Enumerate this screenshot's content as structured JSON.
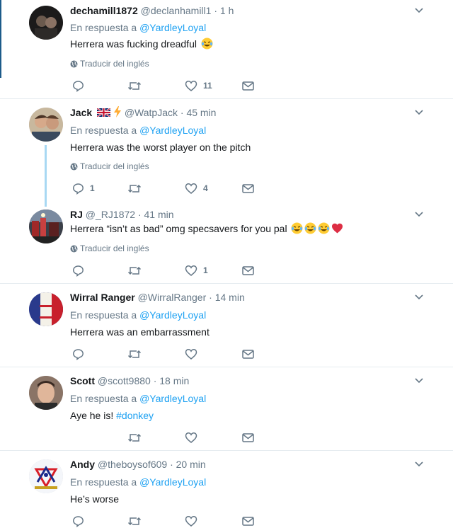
{
  "tweets": [
    {
      "name": "dechamill1872",
      "handle": "@declanhamill1",
      "time": "1 h",
      "reply_prefix": "En respuesta a",
      "reply_to": "@YardleyLoyal",
      "text": "Herrera was fucking dreadful",
      "translate": "Traducir del inglés",
      "reply_count": "",
      "like_count": "11"
    },
    {
      "name": "Jack",
      "handle": "@WatpJack",
      "time": "45 min",
      "reply_prefix": "En respuesta a",
      "reply_to": "@YardleyLoyal",
      "text": "Herrera was the worst player on the pitch",
      "translate": "Traducir del inglés",
      "reply_count": "1",
      "like_count": "4"
    },
    {
      "name": "RJ",
      "handle": "@_RJ1872",
      "time": "41 min",
      "text": "Herrera “isn’t as bad” omg specsavers for you pal",
      "translate": "Traducir del inglés",
      "reply_count": "",
      "like_count": "1"
    },
    {
      "name": "Wirral Ranger",
      "handle": "@WirralRanger",
      "time": "14 min",
      "reply_prefix": "En respuesta a",
      "reply_to": "@YardleyLoyal",
      "text": "Herrera was an embarrassment",
      "reply_count": "",
      "like_count": ""
    },
    {
      "name": "Scott",
      "handle": "@scott9880",
      "time": "18 min",
      "reply_prefix": "En respuesta a",
      "reply_to": "@YardleyLoyal",
      "text": "Aye he is!",
      "hashtag": "#donkey",
      "reply_count": "",
      "like_count": ""
    },
    {
      "name": "Andy",
      "handle": "@theboysof609",
      "time": "20 min",
      "reply_prefix": "En respuesta a",
      "reply_to": "@YardleyLoyal",
      "text": "He’s worse",
      "reply_count": "",
      "like_count": ""
    }
  ],
  "separator": "·",
  "icons": {
    "reply": "reply-icon",
    "retweet": "retweet-icon",
    "like": "heart-icon",
    "dm": "envelope-icon",
    "caret": "chevron-down-icon",
    "globe": "globe-icon"
  },
  "colors": {
    "accent": "#1da1f2",
    "muted": "#657786",
    "thread_line": "#a8d8f3"
  }
}
